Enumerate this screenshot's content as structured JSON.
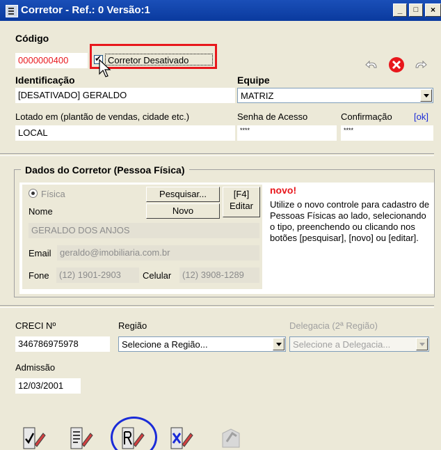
{
  "window": {
    "title": "Corretor - Ref.: 0 Versão:1",
    "buttons": [
      "_",
      "□",
      "×"
    ]
  },
  "codigo": {
    "label": "Código",
    "value": "0000000400"
  },
  "desativado": {
    "label": "Corretor Desativado",
    "checked": true
  },
  "identificacao": {
    "label": "Identificação",
    "value": "[DESATIVADO] GERALDO"
  },
  "equipe": {
    "label": "Equipe",
    "value": "MATRIZ"
  },
  "lotado": {
    "label": "Lotado em (plantão de vendas, cidade etc.)",
    "value": "LOCAL"
  },
  "senha": {
    "label": "Senha de Acesso",
    "value": "****"
  },
  "confirmacao": {
    "label": "Confirmação",
    "ok": "[ok]",
    "value": "****"
  },
  "dados": {
    "title": "Dados do Corretor (Pessoa Física)",
    "tipo": "Física",
    "nome_label": "Nome",
    "nome_value": "GERALDO DOS ANJOS",
    "email_label": "Email",
    "email_value": "geraldo@imobiliaria.com.br",
    "fone_label": "Fone",
    "fone_value": "(12) 1901-2903",
    "celular_label": "Celular",
    "celular_value": "(12) 3908-1289",
    "pesquisar": "Pesquisar...",
    "novo": "Novo",
    "f4": "[F4]",
    "editar": "Editar",
    "info_title": "novo!",
    "info_text": "Utilize o novo controle para cadastro de Pessoas Físicas ao lado, selecionando o tipo, preenchendo ou clicando nos botões [pesquisar], [novo] ou [editar]."
  },
  "creci": {
    "label": "CRECI Nº",
    "value": "346786975978"
  },
  "regiao": {
    "label": "Região",
    "value": "Selecione a Região..."
  },
  "delegacia": {
    "label": "Delegacia (2ª Região)",
    "value": "Selecione a Delegacia..."
  },
  "admissao": {
    "label": "Admissão",
    "value": "12/03/2001"
  },
  "toolbar": [
    "check-document-icon",
    "edit-document-icon",
    "record-icon",
    "delete-document-icon",
    "export-icon"
  ],
  "colors": {
    "code_red": "#e8171c",
    "title_blue": "#0a3a9e",
    "info_red": "#e8171c",
    "ok_blue": "#1a2bd8"
  }
}
